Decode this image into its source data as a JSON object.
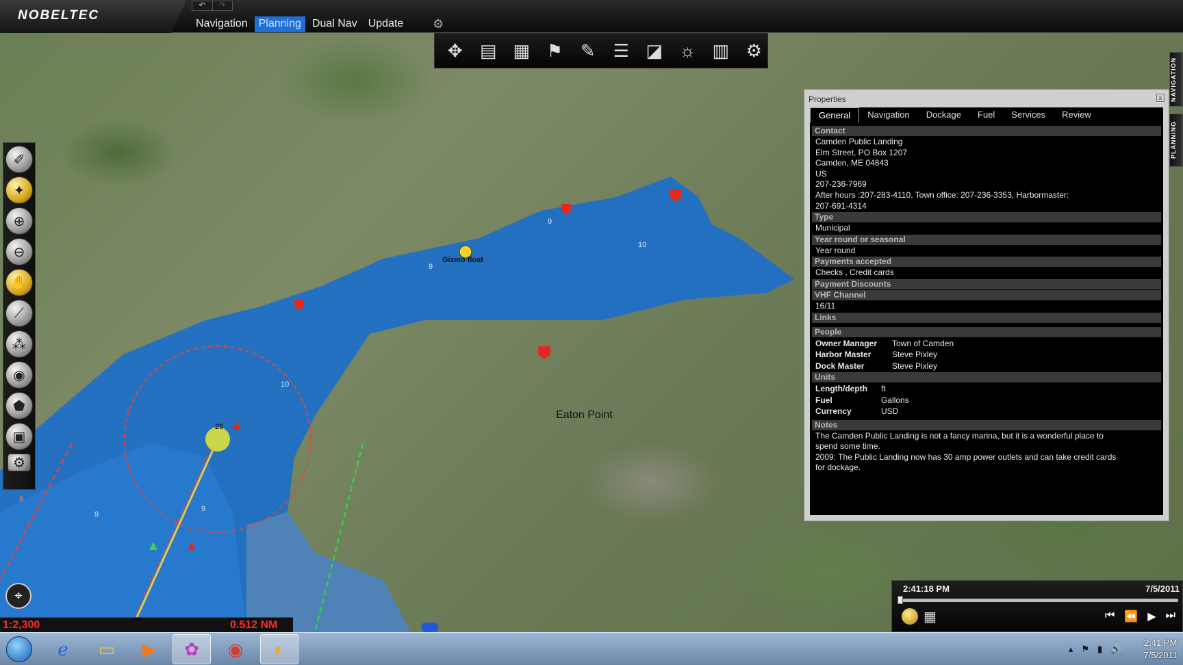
{
  "app": {
    "logo": "NOBELTEC",
    "undo_icon": "undo-icon",
    "redo_icon": "redo-icon"
  },
  "mode_tabs": [
    {
      "label": "Navigation",
      "active": false
    },
    {
      "label": "Planning",
      "active": true
    },
    {
      "label": "Dual Nav",
      "active": false
    },
    {
      "label": "Update",
      "active": false
    }
  ],
  "ribbon_tools": [
    "compass-rose-icon",
    "charts-icon",
    "chart-area-icon",
    "route-waypoint-icon",
    "track-icon",
    "marks-list-icon",
    "chart-layers-icon",
    "weather-icon",
    "tide-table-icon",
    "settings-gear-icon"
  ],
  "left_tools": [
    "select-icon",
    "marks-icon",
    "zoom-in-icon",
    "zoom-out-icon",
    "pan-hand-icon",
    "measure-icon",
    "layers-icon",
    "range-icon",
    "waypoint-icon",
    "area-icon",
    "settings-icon"
  ],
  "side_tabs": {
    "navigation": "NAVIGATION",
    "planning": "PLANNING"
  },
  "map": {
    "labels": {
      "gizmo": "Gizmo float",
      "eaton": "Eaton Point"
    },
    "depths": [
      "9",
      "9",
      "10",
      "10",
      "20",
      "9",
      "9",
      "5"
    ]
  },
  "properties": {
    "title": "Properties",
    "close": "x",
    "tabs": [
      {
        "label": "General",
        "active": true
      },
      {
        "label": "Navigation",
        "active": false
      },
      {
        "label": "Dockage",
        "active": false
      },
      {
        "label": "Fuel",
        "active": false
      },
      {
        "label": "Services",
        "active": false
      },
      {
        "label": "Review",
        "active": false
      }
    ],
    "contact_h": "Contact",
    "contact": [
      "Camden Public Landing",
      "Elm Street, PO Box 1207",
      "Camden, ME 04843",
      "US",
      "207-236-7969",
      "After hours :207-283-4110, Town office: 207-236-3353, Harbormaster:",
      "207-691-4314"
    ],
    "type_h": "Type",
    "type": "Municipal",
    "year_h": "Year round or seasonal",
    "year": "Year round",
    "payments_h": "Payments accepted",
    "payments": "Checks , Credit cards",
    "discounts_h": "Payment Discounts",
    "vhf_h": "VHF Channel",
    "vhf": "16/11",
    "links_h": "Links",
    "people_h": "People",
    "people": [
      {
        "k": "Owner Manager",
        "v": "Town of Camden"
      },
      {
        "k": "Harbor Master",
        "v": "Steve Pixley"
      },
      {
        "k": "Dock Master",
        "v": "Steve Pixley"
      }
    ],
    "units_h": "Units",
    "units": [
      {
        "k": "Length/depth",
        "v": "ft"
      },
      {
        "k": "Fuel",
        "v": "Gallons"
      },
      {
        "k": "Currency",
        "v": "USD"
      }
    ],
    "notes_h": "Notes",
    "notes": [
      "The Camden Public Landing is not a fancy marina, but it is a wonderful place to",
      "spend some time.",
      "2009: The Public Landing now has 30 amp power outlets and can take credit cards",
      "for dockage."
    ]
  },
  "scale": {
    "ratio": "1:2,300",
    "distance": "0.512 NM"
  },
  "player": {
    "time": "2:41:18 PM",
    "date": "7/5/2011"
  },
  "taskbar": {
    "apps": [
      "internet-explorer-icon",
      "file-explorer-icon",
      "media-player-icon",
      "picasa-icon",
      "chrome-icon",
      "nobeltec-icon"
    ],
    "clock_time": "2:41 PM",
    "clock_date": "7/5/2011"
  }
}
